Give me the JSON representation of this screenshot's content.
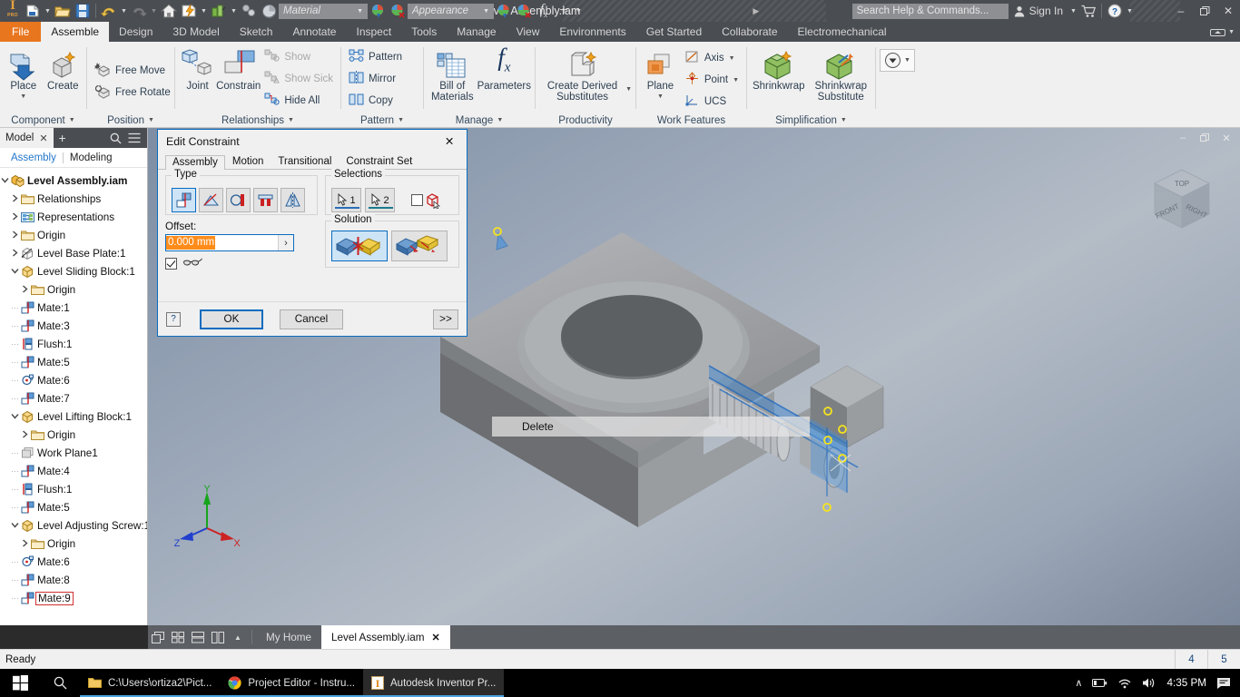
{
  "titlebar": {
    "app_title": "Level Assembly.iam",
    "search_placeholder": "Search Help & Commands...",
    "sign_in": "Sign In",
    "material_placeholder": "Material",
    "appearance_placeholder": "Appearance",
    "minimize": "–",
    "restore": "❐",
    "close": "✕",
    "qat_icons": [
      "inventor-logo",
      "new-file-icon",
      "open-folder-icon",
      "save-icon",
      "undo-icon",
      "redo-icon",
      "home-icon",
      "update-icon",
      "measure-icon",
      "select-icon",
      "appearance-override-icon",
      "material-dropdown",
      "appearance-swatch-icon",
      "appearance-clear-icon",
      "fx-icon",
      "plus-icon",
      "customize-caret"
    ]
  },
  "menu": {
    "file_label": "File",
    "tabs": [
      {
        "label": "Assemble",
        "active": true
      },
      {
        "label": "Design",
        "active": false
      },
      {
        "label": "3D Model",
        "active": false
      },
      {
        "label": "Sketch",
        "active": false
      },
      {
        "label": "Annotate",
        "active": false
      },
      {
        "label": "Inspect",
        "active": false
      },
      {
        "label": "Tools",
        "active": false
      },
      {
        "label": "Manage",
        "active": false
      },
      {
        "label": "View",
        "active": false
      },
      {
        "label": "Environments",
        "active": false
      },
      {
        "label": "Get Started",
        "active": false
      },
      {
        "label": "Collaborate",
        "active": false
      },
      {
        "label": "Electromechanical",
        "active": false
      }
    ]
  },
  "ribbon": {
    "groups": [
      {
        "title": "Component",
        "has_caret": true,
        "big_buttons": [
          {
            "label": "Place",
            "icon": "place-component-icon",
            "has_caret": true
          },
          {
            "label": "Create",
            "icon": "create-component-icon",
            "has_caret": false
          }
        ],
        "small_buttons": []
      },
      {
        "title": "Position",
        "has_caret": true,
        "big_buttons": [],
        "small_buttons": [
          {
            "label": "Free Move",
            "icon": "free-move-icon",
            "disabled": false
          },
          {
            "label": "Free Rotate",
            "icon": "free-rotate-icon",
            "disabled": false
          }
        ]
      },
      {
        "title": "Relationships",
        "has_caret": true,
        "big_buttons": [
          {
            "label": "Joint",
            "icon": "joint-icon",
            "has_caret": false
          },
          {
            "label": "Constrain",
            "icon": "constrain-icon",
            "has_caret": false
          }
        ],
        "small_buttons": [
          {
            "label": "Show",
            "icon": "show-relationships-icon",
            "disabled": true
          },
          {
            "label": "Show Sick",
            "icon": "show-sick-icon",
            "disabled": true
          },
          {
            "label": "Hide All",
            "icon": "hide-all-icon",
            "disabled": false
          }
        ]
      },
      {
        "title": "Pattern",
        "has_caret": true,
        "big_buttons": [],
        "small_buttons": [
          {
            "label": "Pattern",
            "icon": "pattern-icon",
            "disabled": false
          },
          {
            "label": "Mirror",
            "icon": "mirror-icon",
            "disabled": false
          },
          {
            "label": "Copy",
            "icon": "copy-icon",
            "disabled": false
          }
        ]
      },
      {
        "title": "Manage",
        "has_caret": true,
        "big_buttons": [
          {
            "label": "Bill of Materials",
            "icon": "bom-icon",
            "has_caret": false
          },
          {
            "label": "Parameters",
            "icon": "parameters-fx-icon",
            "has_caret": false
          }
        ],
        "small_buttons": []
      },
      {
        "title": "Productivity",
        "has_caret": false,
        "big_buttons": [
          {
            "label": "Create Derived Substitutes",
            "icon": "create-derived-substitutes-icon",
            "has_caret": true
          }
        ],
        "small_buttons": []
      },
      {
        "title": "Work Features",
        "has_caret": false,
        "big_buttons": [
          {
            "label": "Plane",
            "icon": "work-plane-icon",
            "has_caret": true
          }
        ],
        "small_buttons": [
          {
            "label": "Axis",
            "icon": "work-axis-icon",
            "disabled": false,
            "has_caret": true
          },
          {
            "label": "Point",
            "icon": "work-point-icon",
            "disabled": false,
            "has_caret": true
          },
          {
            "label": "UCS",
            "icon": "ucs-icon",
            "disabled": false,
            "has_caret": false
          }
        ]
      },
      {
        "title": "Simplification",
        "has_caret": true,
        "big_buttons": [
          {
            "label": "Shrinkwrap",
            "icon": "shrinkwrap-icon",
            "has_caret": false
          },
          {
            "label": "Shrinkwrap Substitute",
            "icon": "shrinkwrap-substitute-icon",
            "has_caret": false
          }
        ],
        "small_buttons": []
      },
      {
        "title": "",
        "has_caret": false,
        "big_buttons": [],
        "small_buttons": [
          {
            "label": "",
            "icon": "convert-icon",
            "disabled": false,
            "has_caret": true
          }
        ]
      }
    ]
  },
  "browser": {
    "panel_tab": "Model",
    "close_label": "✕",
    "add_label": "+",
    "search_icon": "search-icon",
    "menu_icon": "hamburger-menu-icon",
    "subtabs": [
      {
        "label": "Assembly",
        "selected": true
      },
      {
        "label": "Modeling",
        "selected": false
      }
    ],
    "tree": [
      {
        "label": "Level Assembly.iam",
        "indent": 0,
        "icon": "assembly-icon",
        "expander": "expanded",
        "bold": true,
        "selected": false
      },
      {
        "label": "Relationships",
        "indent": 1,
        "icon": "folder-icon",
        "expander": "collapsed",
        "bold": false,
        "selected": false
      },
      {
        "label": "Representations",
        "indent": 1,
        "icon": "representations-icon",
        "expander": "collapsed",
        "bold": false,
        "selected": false
      },
      {
        "label": "Origin",
        "indent": 1,
        "icon": "folder-icon",
        "expander": "collapsed",
        "bold": false,
        "selected": false
      },
      {
        "label": "Level Base Plate:1",
        "indent": 1,
        "icon": "grounded-part-icon",
        "expander": "collapsed",
        "bold": false,
        "selected": false
      },
      {
        "label": "Level Sliding Block:1",
        "indent": 1,
        "icon": "part-icon",
        "expander": "expanded",
        "bold": false,
        "selected": false
      },
      {
        "label": "Origin",
        "indent": 2,
        "icon": "folder-icon",
        "expander": "collapsed",
        "bold": false,
        "selected": false
      },
      {
        "label": "Mate:1",
        "indent": 2,
        "icon": "mate-icon",
        "expander": "none",
        "bold": false,
        "selected": false
      },
      {
        "label": "Mate:3",
        "indent": 2,
        "icon": "mate-icon",
        "expander": "none",
        "bold": false,
        "selected": false
      },
      {
        "label": "Flush:1",
        "indent": 2,
        "icon": "flush-icon",
        "expander": "none",
        "bold": false,
        "selected": false
      },
      {
        "label": "Mate:5",
        "indent": 2,
        "icon": "mate-icon",
        "expander": "none",
        "bold": false,
        "selected": false
      },
      {
        "label": "Mate:6",
        "indent": 2,
        "icon": "insert-icon",
        "expander": "none",
        "bold": false,
        "selected": false
      },
      {
        "label": "Mate:7",
        "indent": 2,
        "icon": "mate-icon",
        "expander": "none",
        "bold": false,
        "selected": false
      },
      {
        "label": "Level Lifting Block:1",
        "indent": 1,
        "icon": "part-icon",
        "expander": "expanded",
        "bold": false,
        "selected": false
      },
      {
        "label": "Origin",
        "indent": 2,
        "icon": "folder-icon",
        "expander": "collapsed",
        "bold": false,
        "selected": false
      },
      {
        "label": "Work Plane1",
        "indent": 2,
        "icon": "work-plane-tree-icon",
        "expander": "none",
        "bold": false,
        "selected": false
      },
      {
        "label": "Mate:4",
        "indent": 2,
        "icon": "mate-icon",
        "expander": "none",
        "bold": false,
        "selected": false
      },
      {
        "label": "Flush:1",
        "indent": 2,
        "icon": "flush-icon",
        "expander": "none",
        "bold": false,
        "selected": false
      },
      {
        "label": "Mate:5",
        "indent": 2,
        "icon": "mate-icon",
        "expander": "none",
        "bold": false,
        "selected": false
      },
      {
        "label": "Level Adjusting Screw:1",
        "indent": 1,
        "icon": "part-icon",
        "expander": "expanded",
        "bold": false,
        "selected": false
      },
      {
        "label": "Origin",
        "indent": 2,
        "icon": "folder-icon",
        "expander": "collapsed",
        "bold": false,
        "selected": false
      },
      {
        "label": "Mate:6",
        "indent": 2,
        "icon": "insert-icon",
        "expander": "none",
        "bold": false,
        "selected": false
      },
      {
        "label": "Mate:8",
        "indent": 2,
        "icon": "mate-icon",
        "expander": "none",
        "bold": false,
        "selected": false
      },
      {
        "label": "Mate:9",
        "indent": 2,
        "icon": "mate-icon",
        "expander": "none",
        "bold": false,
        "selected": true
      }
    ]
  },
  "dialog": {
    "title": "Edit Constraint",
    "close_label": "✕",
    "tabs": [
      {
        "label": "Assembly",
        "active": true
      },
      {
        "label": "Motion",
        "active": false
      },
      {
        "label": "Transitional",
        "active": false
      },
      {
        "label": "Constraint Set",
        "active": false
      }
    ],
    "type_legend": "Type",
    "type_buttons": [
      {
        "icon": "mate-constraint-icon",
        "selected": true
      },
      {
        "icon": "angle-constraint-icon",
        "selected": false
      },
      {
        "icon": "tangent-constraint-icon",
        "selected": false
      },
      {
        "icon": "insert-constraint-icon",
        "selected": false
      },
      {
        "icon": "symmetry-constraint-icon",
        "selected": false
      }
    ],
    "selections_legend": "Selections",
    "selection_buttons": [
      {
        "label": "1",
        "icon": "select-first-icon"
      },
      {
        "label": "2",
        "icon": "select-second-icon"
      }
    ],
    "pick_part_checked": false,
    "pick_part_icon": "pick-part-first-icon",
    "offset_label": "Offset:",
    "offset_value": "0.000 mm",
    "offset_caret": "›",
    "predict_checked": true,
    "predict_icon": "show-preview-glasses-icon",
    "solution_legend": "Solution",
    "solution_buttons": [
      {
        "icon": "mate-solution-icon",
        "selected": true
      },
      {
        "icon": "flush-solution-icon",
        "selected": false
      }
    ],
    "help_label": "?",
    "ok_label": "OK",
    "cancel_label": "Cancel",
    "more_label": ">>"
  },
  "viewport": {
    "context_menu_item": "Delete",
    "viewcube": {
      "top": "TOP",
      "front": "FRONT",
      "right": "RIGHT"
    },
    "triad": {
      "x": "X",
      "y": "Y",
      "z": "Z"
    },
    "win_minimize": "–",
    "win_restore": "❐",
    "win_close": "✕"
  },
  "doctabs": {
    "view_icons": [
      "tile-windows-icon",
      "grid-view-icon",
      "horizontal-split-icon",
      "vertical-split-icon",
      "more-views-caret"
    ],
    "tabs": [
      {
        "label": "My Home",
        "active": false,
        "closable": false
      },
      {
        "label": "Level Assembly.iam",
        "active": true,
        "closable": true,
        "close_label": "✕"
      }
    ]
  },
  "statusbar": {
    "message": "Ready",
    "cell_1": "4",
    "cell_2": "5"
  },
  "taskbar": {
    "start_icon": "windows-start-icon",
    "search_icon": "taskbar-search-icon",
    "apps": [
      {
        "label": "C:\\Users\\ortiza2\\Pict...",
        "icon": "folder-explorer-icon",
        "active": false
      },
      {
        "label": "Project Editor - Instru...",
        "icon": "chrome-icon",
        "active": false
      },
      {
        "label": "Autodesk Inventor Pr...",
        "icon": "inventor-taskbar-icon",
        "active": true
      }
    ],
    "tray": {
      "chevron": "∧",
      "battery_icon": "battery-icon",
      "wifi_icon": "wifi-icon",
      "volume_icon": "volume-icon",
      "clock": "4:35 PM",
      "notification_icon": "notification-icon"
    }
  }
}
